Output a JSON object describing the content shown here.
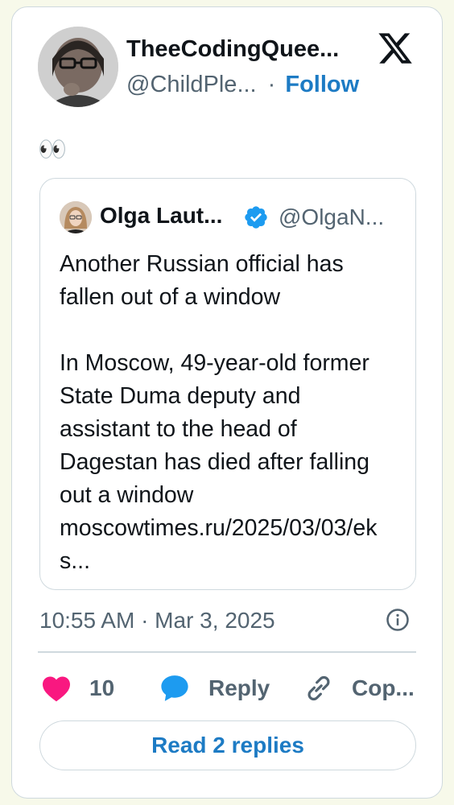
{
  "author": {
    "name": "TheeCodingQuee...",
    "handle": "@ChildPle...",
    "separator": "·",
    "follow_label": "Follow"
  },
  "tweet_text": "👀",
  "quoted": {
    "name": "Olga Laut...",
    "handle": "@OlgaN...",
    "paragraph1": "Another Russian official has\nfallen out of a window",
    "paragraph2": "In Moscow, 49-year-old former\nState Duma deputy and\nassistant to the head of\nDagestan has died after falling\nout a window",
    "link": "moscowtimes.ru/2025/03/03/eks..."
  },
  "timestamp": "10:55 AM · Mar 3, 2025",
  "actions": {
    "like_count": "10",
    "reply_label": "Reply",
    "copy_label": "Cop..."
  },
  "read_replies_label": "Read 2 replies",
  "icons": {
    "platform": "x-logo-icon",
    "like": "heart-icon",
    "reply": "speech-bubble-icon",
    "copy": "link-icon",
    "info": "info-icon",
    "verified": "verified-badge-icon"
  },
  "colors": {
    "accent": "#1d7bc4",
    "like": "#f91880",
    "reply_icon": "#1d9bf0",
    "muted": "#536471"
  }
}
